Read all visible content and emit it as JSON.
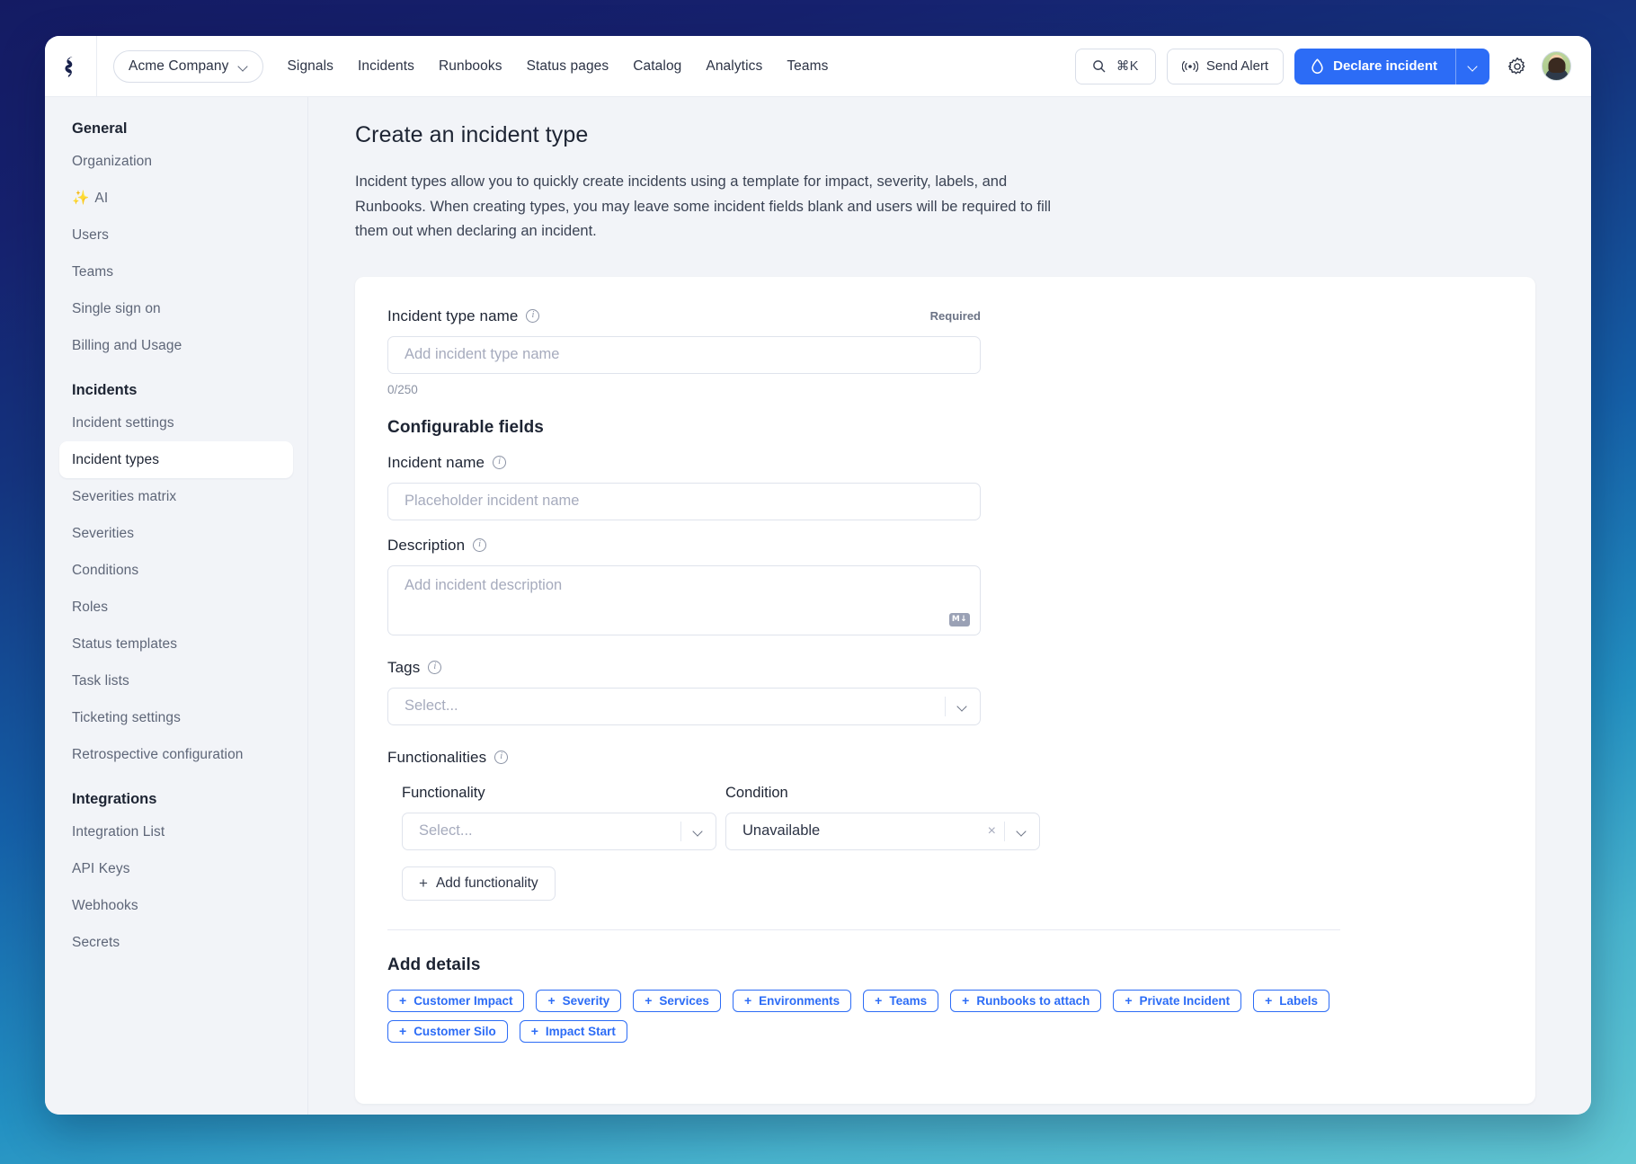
{
  "header": {
    "logo_name": "signals-logo",
    "org_switcher": {
      "label": "Acme Company"
    },
    "nav": [
      {
        "label": "Signals"
      },
      {
        "label": "Incidents"
      },
      {
        "label": "Runbooks"
      },
      {
        "label": "Status pages"
      },
      {
        "label": "Catalog"
      },
      {
        "label": "Analytics"
      },
      {
        "label": "Teams"
      }
    ],
    "search": {
      "shortcut": "⌘K"
    },
    "send_alert": {
      "label": "Send Alert"
    },
    "declare": {
      "label": "Declare incident"
    }
  },
  "sidebar": {
    "groups": [
      {
        "title": "General",
        "items": [
          {
            "label": "Organization",
            "active": false
          },
          {
            "label": "AI",
            "active": false,
            "icon": "sparkles"
          },
          {
            "label": "Users",
            "active": false
          },
          {
            "label": "Teams",
            "active": false
          },
          {
            "label": "Single sign on",
            "active": false
          },
          {
            "label": "Billing and Usage",
            "active": false
          }
        ]
      },
      {
        "title": "Incidents",
        "items": [
          {
            "label": "Incident settings",
            "active": false
          },
          {
            "label": "Incident types",
            "active": true
          },
          {
            "label": "Severities matrix",
            "active": false
          },
          {
            "label": "Severities",
            "active": false
          },
          {
            "label": "Conditions",
            "active": false
          },
          {
            "label": "Roles",
            "active": false
          },
          {
            "label": "Status templates",
            "active": false
          },
          {
            "label": "Task lists",
            "active": false
          },
          {
            "label": "Ticketing settings",
            "active": false
          },
          {
            "label": "Retrospective configuration",
            "active": false
          }
        ]
      },
      {
        "title": "Integrations",
        "items": [
          {
            "label": "Integration List",
            "active": false
          },
          {
            "label": "API Keys",
            "active": false
          },
          {
            "label": "Webhooks",
            "active": false
          },
          {
            "label": "Secrets",
            "active": false
          }
        ]
      }
    ]
  },
  "page": {
    "title": "Create an incident type",
    "description": "Incident types allow you to quickly create incidents using a template for impact, severity, labels, and Runbooks. When creating types, you may leave some incident fields blank and users will be required to fill them out when declaring an incident."
  },
  "form": {
    "incident_type_name": {
      "label": "Incident type name",
      "required_tag": "Required",
      "placeholder": "Add incident type name",
      "value": "",
      "char_count": "0/250"
    },
    "configurable_fields_title": "Configurable fields",
    "incident_name": {
      "label": "Incident name",
      "placeholder": "Placeholder incident name",
      "value": ""
    },
    "description": {
      "label": "Description",
      "placeholder": "Add incident description",
      "value": "",
      "markdown_badge": "M↓"
    },
    "tags": {
      "label": "Tags",
      "placeholder": "Select...",
      "value": ""
    },
    "functionalities": {
      "label": "Functionalities",
      "col_functionality": "Functionality",
      "col_condition": "Condition",
      "functionality_placeholder": "Select...",
      "functionality_value": "",
      "condition_value": "Unavailable",
      "add_button": "Add functionality"
    },
    "add_details": {
      "title": "Add details",
      "chips": [
        {
          "label": "Customer Impact"
        },
        {
          "label": "Severity"
        },
        {
          "label": "Services"
        },
        {
          "label": "Environments"
        },
        {
          "label": "Teams"
        },
        {
          "label": "Runbooks to attach"
        },
        {
          "label": "Private Incident"
        },
        {
          "label": "Labels"
        },
        {
          "label": "Customer Silo"
        },
        {
          "label": "Impact Start"
        }
      ]
    }
  },
  "colors": {
    "accent_blue": "#2c6cf6",
    "bg_gradient_top": "#141b63",
    "bg_gradient_bottom": "#62c8d4",
    "sidebar_bg": "#f2f4f8",
    "card_bg": "#ffffff"
  }
}
